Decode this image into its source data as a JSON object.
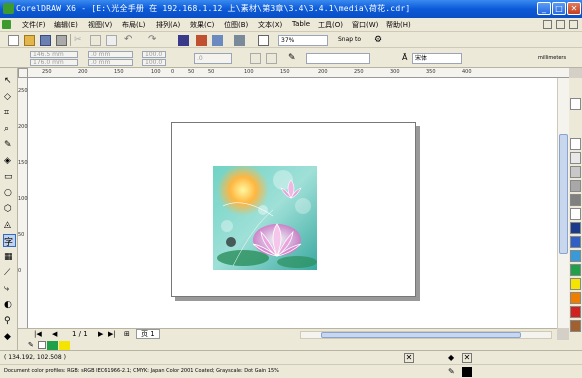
{
  "title": "CorelDRAW X6 - [E:\\光全手册 在 192.168.1.12 上\\素材\\第3章\\3.4\\3.4.1\\media\\荷花.cdr]",
  "menu": [
    "文件(F)",
    "编辑(E)",
    "视图(V)",
    "布局(L)",
    "排列(A)",
    "效果(C)",
    "位图(B)",
    "文本(X)",
    "Table",
    "工具(O)",
    "窗口(W)",
    "帮助(H)"
  ],
  "standard": {
    "zoom": "37%",
    "snap": "Snap to"
  },
  "props": {
    "x": "146.5 mm",
    "y": "176.0 mm",
    "w": ".0 mm",
    "h": ".0 mm",
    "sx": "100.0",
    "sy": "100.0",
    "angle": ".0",
    "font": "宋体",
    "units": "millimeters"
  },
  "ruler_h": [
    "250",
    "200",
    "150",
    "100",
    "50",
    "0",
    "50",
    "100",
    "150",
    "200",
    "250",
    "300",
    "350",
    "400"
  ],
  "ruler_v": [
    "250",
    "200",
    "150",
    "100",
    "50",
    "0"
  ],
  "nav": {
    "page_count": "1 / 1",
    "page_tab": "页 1"
  },
  "status": {
    "coords": "( 134.192, 102.508 )",
    "color_profiles": "Document color profiles: RGB: sRGB IEC61966-2.1; CMYK: Japan Color 2001 Coated; Grayscale: Dot Gain 15%"
  },
  "colors": {
    "titlebar": "#0a4fc4",
    "palette": [
      "#ffffff",
      "#000000",
      "#1b3a8c",
      "#2f5fc4",
      "#3a9ad8",
      "#21a04a",
      "#f5e400",
      "#ee7d00",
      "#d02020",
      "#a06030"
    ]
  }
}
